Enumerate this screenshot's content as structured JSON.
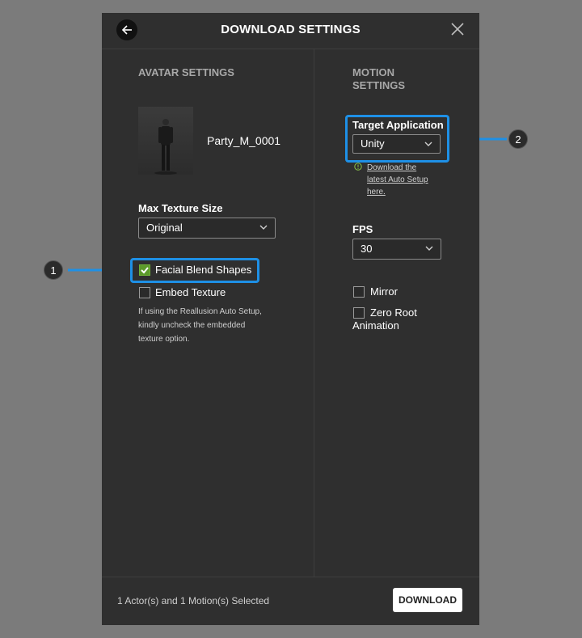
{
  "dialog": {
    "title": "DOWNLOAD SETTINGS",
    "back_icon": "back-arrow-icon",
    "close_icon": "close-icon"
  },
  "avatar_settings": {
    "section_title": "AVATAR SETTINGS",
    "avatar_name": "Party_M_0001",
    "max_texture_label": "Max Texture Size",
    "max_texture_value": "Original",
    "facial_blend_label": "Facial Blend Shapes",
    "facial_blend_checked": true,
    "embed_texture_label": "Embed Texture",
    "embed_texture_checked": false,
    "note_line1": "If using the Reallusion Auto Setup,",
    "note_line2": "kindly uncheck the embedded",
    "note_line3": "texture option."
  },
  "motion_settings": {
    "section_title_line1": "MOTION",
    "section_title_line2": "SETTINGS",
    "target_app_label": "Target Application",
    "target_app_value": "Unity",
    "link_line1": "Download the",
    "link_line2": "latest Auto Setup",
    "link_line3": "here.",
    "fps_label": "FPS",
    "fps_value": "30",
    "mirror_label": "Mirror",
    "mirror_checked": false,
    "zero_root_label_line1": "Zero Root",
    "zero_root_label_line2": "Animation",
    "zero_root_checked": false
  },
  "footer": {
    "status": "1 Actor(s) and 1 Motion(s) Selected",
    "download_label": "DOWNLOAD"
  },
  "callouts": {
    "one": "1",
    "two": "2"
  },
  "colors": {
    "highlight": "#1e90e6",
    "checkbox_checked": "#5c9a2b",
    "info_icon": "#8bc34a"
  }
}
